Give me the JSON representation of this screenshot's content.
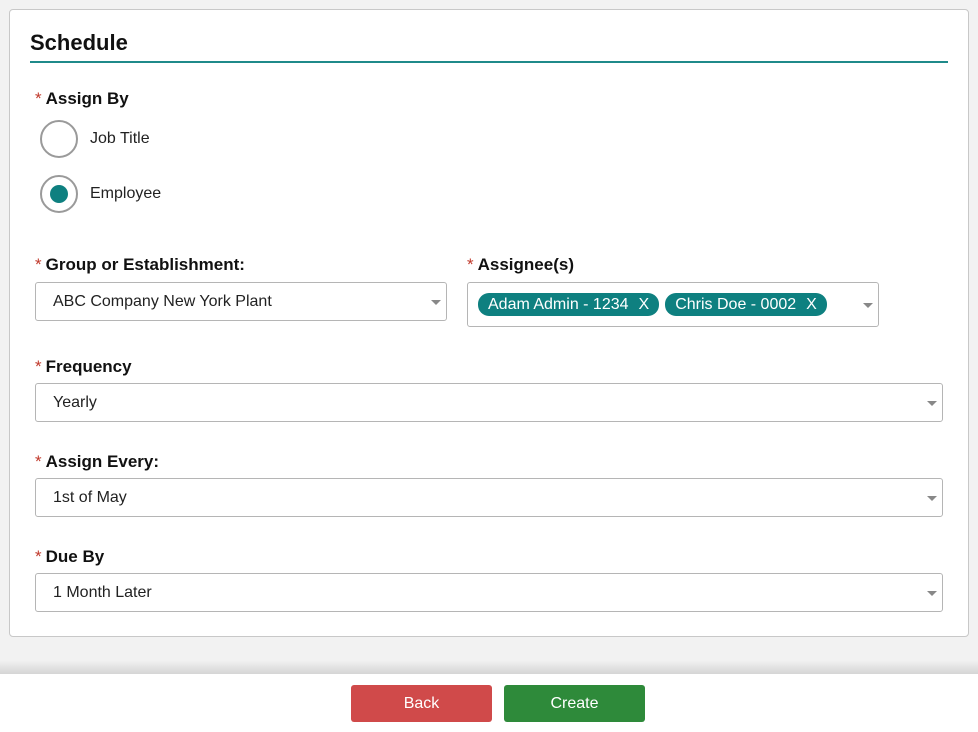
{
  "section": {
    "title": "Schedule"
  },
  "assign_by": {
    "label": "Assign By",
    "options": [
      {
        "label": "Job Title",
        "checked": false
      },
      {
        "label": "Employee",
        "checked": true
      }
    ]
  },
  "group": {
    "label": "Group or Establishment:",
    "value": "ABC Company New York Plant"
  },
  "assignees": {
    "label": "Assignee(s)",
    "chips": [
      {
        "label": "Adam Admin - 1234",
        "remove": "X"
      },
      {
        "label": "Chris Doe - 0002",
        "remove": "X"
      }
    ]
  },
  "frequency": {
    "label": "Frequency",
    "value": "Yearly"
  },
  "assign_every": {
    "label": "Assign Every:",
    "value": "1st of May"
  },
  "due_by": {
    "label": "Due By",
    "value": "1 Month Later"
  },
  "required_marker": "*",
  "footer": {
    "back_label": "Back",
    "create_label": "Create"
  },
  "colors": {
    "accent": "#0e8080",
    "required": "#c0392b",
    "back_button": "#d04a4a",
    "create_button": "#2e8a3a"
  }
}
